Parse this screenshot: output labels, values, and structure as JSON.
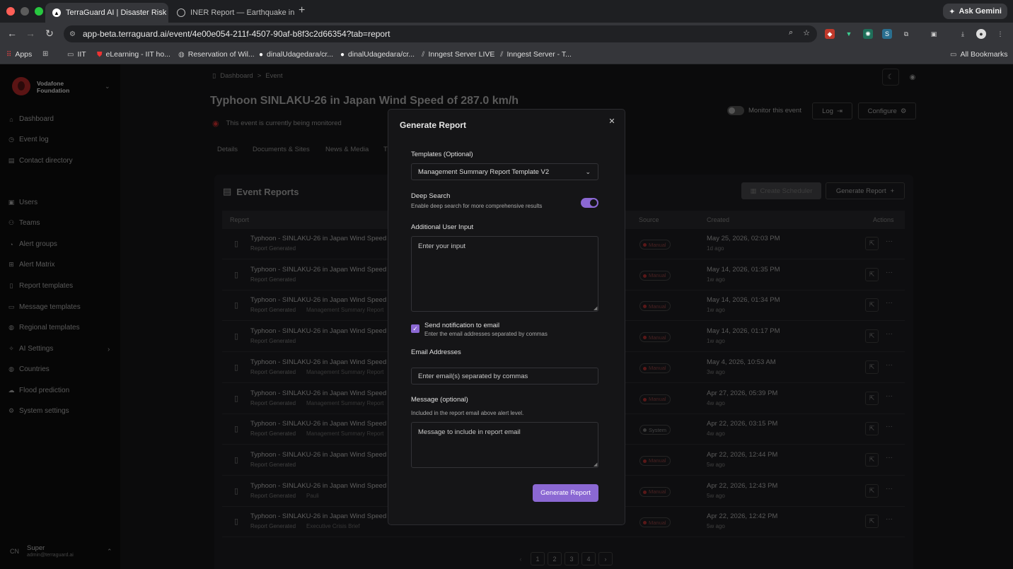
{
  "browser": {
    "tabs": [
      {
        "title": "TerraGuard AI | Disaster Risk Ma...",
        "active": true,
        "icon": "terraguard-favicon"
      },
      {
        "title": "INER Report — Earthquake in...",
        "active": false,
        "icon": "globe-favicon"
      }
    ],
    "ask_gemini": "Ask Gemini",
    "url_domain": "app-beta.terraguard.ai",
    "url_path": "/event/4e00e054-211f-4507-90af-b8f3c2d66354?tab=report",
    "bookmarks": [
      {
        "label": "Apps",
        "icon": "grid-icon"
      },
      {
        "label": "",
        "icon": "tab-groups-icon"
      },
      {
        "label": "IIT",
        "icon": "folder-icon"
      },
      {
        "label": "eLearning - IIT ho...",
        "icon": "shield-icon"
      },
      {
        "label": "Reservation of Wil...",
        "icon": "globe-icon"
      },
      {
        "label": "dinalUdagedara/cr...",
        "icon": "github-icon"
      },
      {
        "label": "dinalUdagedara/cr...",
        "icon": "github-icon"
      },
      {
        "label": "Inngest Server LIVE",
        "icon": "inngest-icon"
      },
      {
        "label": "Inngest Server - T...",
        "icon": "inngest-icon"
      }
    ],
    "all_bookmarks": "All Bookmarks"
  },
  "sidebar": {
    "org_line1": "Vodafone",
    "org_line2": "Foundation",
    "items": [
      {
        "label": "Dashboard",
        "icon": "home-icon"
      },
      {
        "label": "Event log",
        "icon": "event-log-icon"
      },
      {
        "label": "Contact directory",
        "icon": "contacts-icon"
      },
      {
        "label": "Users",
        "icon": "user-icon"
      },
      {
        "label": "Teams",
        "icon": "teams-icon"
      },
      {
        "label": "Alert groups",
        "icon": "alert-group-icon"
      },
      {
        "label": "Alert Matrix",
        "icon": "matrix-icon"
      },
      {
        "label": "Report templates",
        "icon": "report-icon"
      },
      {
        "label": "Message templates",
        "icon": "message-icon"
      },
      {
        "label": "Regional templates",
        "icon": "region-icon"
      },
      {
        "label": "AI Settings",
        "icon": "ai-icon"
      },
      {
        "label": "Countries",
        "icon": "globe-icon"
      },
      {
        "label": "Flood prediction",
        "icon": "cloud-icon"
      },
      {
        "label": "System settings",
        "icon": "gear-icon"
      }
    ],
    "user": {
      "initials": "CN",
      "name": "Super",
      "email": "admin@terraguard.ai"
    }
  },
  "page": {
    "breadcrumb": [
      "Dashboard",
      "Event"
    ],
    "title": "Typhoon SINLAKU-26 in Japan Wind Speed of 287.0 km/h",
    "monitor_note": "This event is currently being monitored",
    "monitor_toggle_label": "Monitor this event",
    "log_label": "Log",
    "configure_label": "Configure",
    "tabs": [
      "Details",
      "Documents & Sites",
      "News & Media",
      "T"
    ]
  },
  "reports": {
    "title": "Event Reports",
    "create_scheduler": "Create Scheduler",
    "generate_report": "Generate Report",
    "columns": {
      "report": "Report",
      "source": "Source",
      "created": "Created",
      "actions": "Actions"
    },
    "rows": [
      {
        "title": "Typhoon - SINLAKU-26 in Japan Wind Speed",
        "status": "Report Generated",
        "template": "",
        "source": "Manual",
        "date": "May 25, 2026, 02:03 PM",
        "ago": "1d ago"
      },
      {
        "title": "Typhoon - SINLAKU-26 in Japan Wind Speed",
        "status": "Report Generated",
        "template": "",
        "source": "Manual",
        "date": "May 14, 2026, 01:35 PM",
        "ago": "1w ago"
      },
      {
        "title": "Typhoon - SINLAKU-26 in Japan Wind Speed",
        "status": "Report Generated",
        "template": "Management Summary Report",
        "source": "Manual",
        "date": "May 14, 2026, 01:34 PM",
        "ago": "1w ago"
      },
      {
        "title": "Typhoon - SINLAKU-26 in Japan Wind Speed",
        "status": "Report Generated",
        "template": "",
        "source": "Manual",
        "date": "May 14, 2026, 01:17 PM",
        "ago": "1w ago"
      },
      {
        "title": "Typhoon - SINLAKU-26 in Japan Wind Speed",
        "status": "Report Generated",
        "template": "Management Summary Report",
        "source": "Manual",
        "date": "May 4, 2026, 10:53 AM",
        "ago": "3w ago"
      },
      {
        "title": "Typhoon - SINLAKU-26 in Japan Wind Speed",
        "status": "Report Generated",
        "template": "Management Summary Report",
        "source": "Manual",
        "date": "Apr 27, 2026, 05:39 PM",
        "ago": "4w ago"
      },
      {
        "title": "Typhoon - SINLAKU-26 in Japan Wind Speed",
        "status": "Report Generated",
        "template": "Management Summary Report",
        "source": "System",
        "date": "Apr 22, 2026, 03:15 PM",
        "ago": "4w ago"
      },
      {
        "title": "Typhoon - SINLAKU-26 in Japan Wind Speed",
        "status": "Report Generated",
        "template": "",
        "source": "Manual",
        "date": "Apr 22, 2026, 12:44 PM",
        "ago": "5w ago"
      },
      {
        "title": "Typhoon - SINLAKU-26 in Japan Wind Speed",
        "status": "Report Generated",
        "template": "Pauli",
        "source": "Manual",
        "date": "Apr 22, 2026, 12:43 PM",
        "ago": "5w ago"
      },
      {
        "title": "Typhoon - SINLAKU-26 in Japan Wind Speed",
        "status": "Report Generated",
        "template": "Executive Crisis Brief",
        "source": "Manual",
        "date": "Apr 22, 2026, 12:42 PM",
        "ago": "5w ago"
      }
    ],
    "pages": [
      "1",
      "2",
      "3",
      "4"
    ]
  },
  "modal": {
    "title": "Generate Report",
    "templates_label": "Templates (Optional)",
    "template_selected": "Management Summary Report Template V2",
    "deep_search_label": "Deep Search",
    "deep_search_help": "Enable deep search for more comprehensive results",
    "deep_search_on": true,
    "additional_input_label": "Additional User Input",
    "additional_input_placeholder": "Enter your input",
    "notify_label": "Send notification to email",
    "notify_help": "Enter the email addresses separated by commas",
    "notify_checked": true,
    "email_label": "Email Addresses",
    "email_placeholder": "Enter email(s) separated by commas",
    "message_label": "Message (optional)",
    "message_help": "Included in the report email above alert level.",
    "message_placeholder": "Message to include in report email",
    "submit_label": "Generate Report"
  },
  "colors": {
    "accent": "#8b68d3",
    "manual_badge": "#5a1818",
    "overlay": "#000000"
  }
}
